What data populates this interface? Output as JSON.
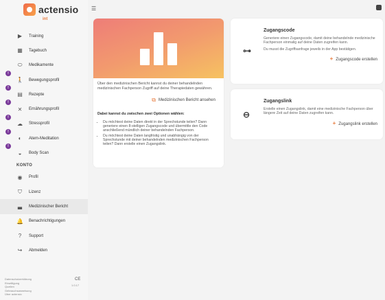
{
  "brand": {
    "name": "actensio",
    "sub": "int"
  },
  "sidebar": {
    "items": [
      {
        "label": "Training",
        "icon": "play-icon",
        "glyph": "▶",
        "badge": ""
      },
      {
        "label": "Tagebuch",
        "icon": "calculator-icon",
        "glyph": "▦",
        "badge": ""
      },
      {
        "label": "Medikamente",
        "icon": "pill-icon",
        "glyph": "⬭",
        "badge": ""
      },
      {
        "label": "Bewegungsprofil",
        "icon": "walking-icon",
        "glyph": "🚶",
        "badge": "!"
      },
      {
        "label": "Rezepte",
        "icon": "recipe-icon",
        "glyph": "▤",
        "badge": "!"
      },
      {
        "label": "Ernährungsprofil",
        "icon": "utensils-icon",
        "glyph": "✕",
        "badge": "!"
      },
      {
        "label": "Stressprofil",
        "icon": "stress-icon",
        "glyph": "☁",
        "badge": "!"
      },
      {
        "label": "Atem-Meditation",
        "icon": "meditation-icon",
        "glyph": "◐",
        "badge": "!"
      },
      {
        "label": "Body Scan",
        "icon": "body-scan-icon",
        "glyph": "◒",
        "badge": "!"
      }
    ],
    "section_label": "KONTO",
    "account_items": [
      {
        "label": "Profil",
        "icon": "profile-icon",
        "glyph": "◉"
      },
      {
        "label": "Lizenz",
        "icon": "license-shield-icon",
        "glyph": "⛉"
      },
      {
        "label": "Medizinischer Bericht",
        "icon": "bar-chart-icon",
        "glyph": "▃"
      },
      {
        "label": "Benachrichtigungen",
        "icon": "bell-icon",
        "glyph": "🔔"
      },
      {
        "label": "Support",
        "icon": "help-icon",
        "glyph": "?"
      },
      {
        "label": "Abmelden",
        "icon": "logout-icon",
        "glyph": "↪"
      }
    ],
    "footer_links": [
      "Datenschutzerklärung",
      "Einwilligung",
      "Quellen",
      "Gebrauchsanweisung",
      "Über actensio"
    ],
    "ce": "CE",
    "version": "1.0.17"
  },
  "main": {
    "intro": "Über den medizinischen Bericht kannst du deiner behandelnden medizinischen Fachperson Zugriff auf deine Therapiedaten gewähren.",
    "report_link": "Medizinischen Bericht ansehen",
    "options_title": "Dabei kannst du zwischen zwei Optionen wählen:",
    "options": [
      "Du möchtest deine Daten direkt in der Sprechstunde teilen? Dann generiere einen 8-stelligen Zugangscode und übermittle den Code anschließend mündlich deiner behandelnden Fachperson.",
      "Du möchtest deine Daten langfristig und unabhängig von der Sprechstunde mit deiner behandelnden medizinischen Fachperson teilen? Dann erstelle einen Zugangslink."
    ]
  },
  "code_card": {
    "title": "Zugangscode",
    "text1": "Generiere einen Zugangscode, damit deine behandelnde medizinische Fachperson einmalig auf deine Daten zugreifen kann.",
    "text2": "Du musst die Zugriffsanfrage jeweils in der App bestätigen.",
    "action": "Zugangscode erstellen"
  },
  "link_card": {
    "title": "Zugangslink",
    "text1": "Erstelle einen Zugangslink, damit eine medizinische Fachperson über längere Zeit auf deine Daten zugreifen kann.",
    "action": "Zugangslink erstellen"
  },
  "colors": {
    "accent": "#e77b3d",
    "badge": "#7a3a9a"
  }
}
